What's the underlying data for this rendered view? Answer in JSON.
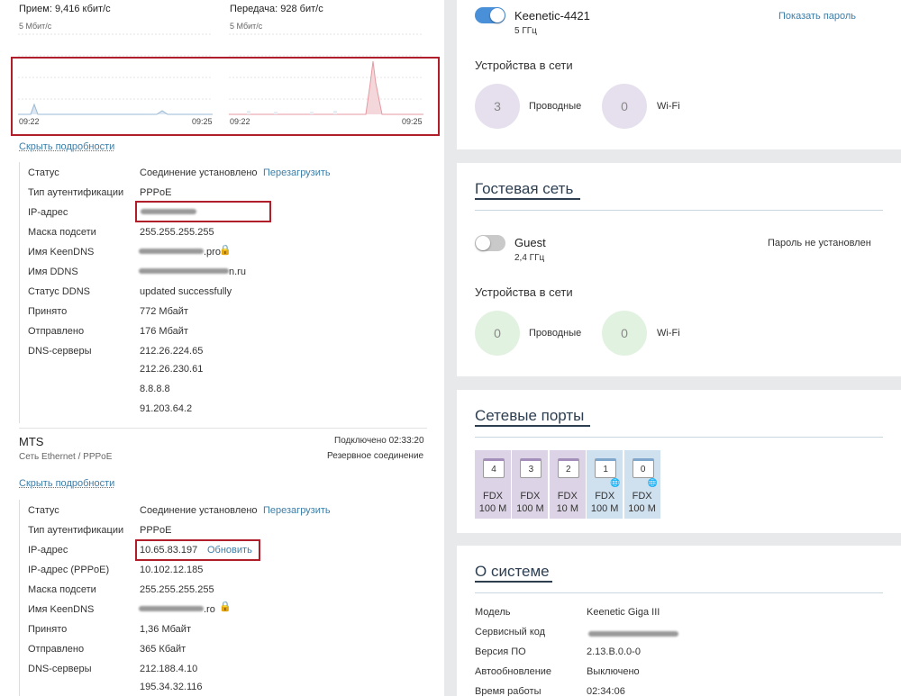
{
  "left": {
    "rx_label": "Прием: 9,416 кбит/с",
    "tx_label": "Передача: 928 бит/с",
    "rx_scale": "5 Мбит/с",
    "tx_scale": "5 Мбит/с",
    "rx_t0": "09:22",
    "rx_t1": "09:25",
    "tx_t0": "09:22",
    "tx_t1": "09:25",
    "hide_details": "Скрыть подробности",
    "conn1": {
      "rows": [
        {
          "k": "Статус",
          "v": "Соединение установлено"
        },
        {
          "k": "Тип аутентификации",
          "v": "PPPoE"
        },
        {
          "k": "IP-адрес",
          "v": ""
        },
        {
          "k": "Маска подсети",
          "v": "255.255.255.255"
        },
        {
          "k": "Имя KeenDNS",
          "v": ".pro"
        },
        {
          "k": "Имя DDNS",
          "v": "n.ru"
        },
        {
          "k": "Статус DDNS",
          "v": "updated successfully"
        },
        {
          "k": "Принято",
          "v": "772 Мбайт"
        },
        {
          "k": "Отправлено",
          "v": "176 Мбайт"
        },
        {
          "k": "DNS-серверы",
          "v": "212.26.224.65"
        }
      ],
      "dns_extra": [
        "212.26.230.61",
        "8.8.8.8",
        "91.203.64.2"
      ],
      "restart": "Перезагрузить"
    },
    "mts": {
      "name": "MTS",
      "type": "Сеть Ethernet / PPPoE",
      "status": "Подключено 02:33:20",
      "role": "Резервное соединение",
      "hide_details": "Скрыть подробности",
      "restart": "Перезагрузить",
      "refresh": "Обновить",
      "rows": [
        {
          "k": "Статус",
          "v": "Соединение установлено"
        },
        {
          "k": "Тип аутентификации",
          "v": "PPPoE"
        },
        {
          "k": "IP-адрес",
          "v": "10.65.83.197"
        },
        {
          "k": "IP-адрес (PPPoE)",
          "v": "10.102.12.185"
        },
        {
          "k": "Маска подсети",
          "v": "255.255.255.255"
        },
        {
          "k": "Имя KeenDNS",
          "v": ".ro"
        },
        {
          "k": "Принято",
          "v": "1,36 Мбайт"
        },
        {
          "k": "Отправлено",
          "v": "365 Кбайт"
        },
        {
          "k": "DNS-серверы",
          "v": "212.188.4.10"
        }
      ],
      "dns_extra": [
        "195.34.32.116"
      ]
    }
  },
  "wifi": {
    "ssid": "Keenetic-4421",
    "band": "5 ГГц",
    "show_password": "Показать пароль",
    "devices_title": "Устройства в сети",
    "wired_count": "3",
    "wired_label": "Проводные",
    "wifi_count": "0",
    "wifi_label": "Wi-Fi"
  },
  "guest": {
    "title": "Гостевая сеть",
    "ssid": "Guest",
    "band": "2,4 ГГц",
    "password_status": "Пароль не установлен",
    "devices_title": "Устройства в сети",
    "wired_count": "0",
    "wired_label": "Проводные",
    "wifi_count": "0",
    "wifi_label": "Wi-Fi"
  },
  "ports": {
    "title": "Сетевые порты",
    "items": [
      {
        "num": "4",
        "duplex": "FDX",
        "speed": "100 M",
        "wan": false
      },
      {
        "num": "3",
        "duplex": "FDX",
        "speed": "100 M",
        "wan": false
      },
      {
        "num": "2",
        "duplex": "FDX",
        "speed": "10 M",
        "wan": false
      },
      {
        "num": "1",
        "duplex": "FDX",
        "speed": "100 M",
        "wan": true
      },
      {
        "num": "0",
        "duplex": "FDX",
        "speed": "100 M",
        "wan": true
      }
    ]
  },
  "system": {
    "title": "О системе",
    "rows": [
      {
        "k": "Модель",
        "v": "Keenetic Giga III"
      },
      {
        "k": "Сервисный код",
        "v": ""
      },
      {
        "k": "Версия ПО",
        "v": "2.13.B.0.0-0"
      },
      {
        "k": "Автообновление",
        "v": "Выключено"
      },
      {
        "k": "Время работы",
        "v": "02:34:06"
      }
    ]
  },
  "colors": {
    "accent": "#4a90d9",
    "lan_port": "#ddd3e6",
    "wan_port": "#cfe0ef",
    "highlight_box": "#b01e2a",
    "guest_circle": "#e2f2e0",
    "home_circle": "#e6e0ee"
  }
}
